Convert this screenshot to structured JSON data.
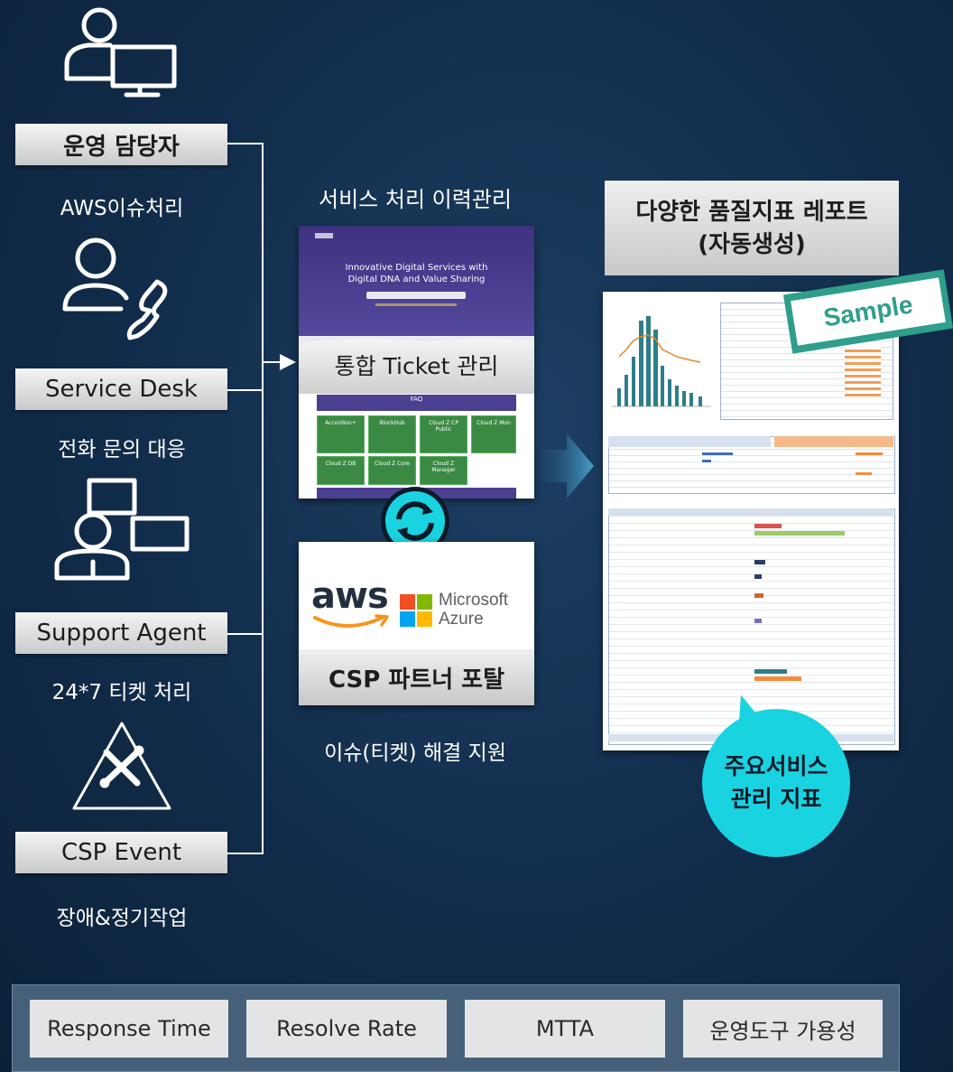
{
  "roles": [
    {
      "label": "운영 담당자",
      "caption": "AWS이슈처리",
      "icon": "user-monitor-icon"
    },
    {
      "label": "Service Desk",
      "caption": "전화 문의 대응",
      "icon": "user-phone-icon"
    },
    {
      "label": "Support Agent",
      "caption": "24*7 티켓 처리",
      "icon": "user-screens-icon"
    },
    {
      "label": "CSP Event",
      "caption": "장애&정기작업",
      "icon": "warning-tools-icon"
    }
  ],
  "middle": {
    "top_caption": "서비스 처리 이력관리",
    "ticket_label": "통합 Ticket 관리",
    "portal_hero_title": "Innovative Digital Services with Digital DNA and Value Sharing",
    "portal_faq": "FAQ",
    "portal_tiles": [
      "Accordion+",
      "BlockHub",
      "Cloud Z CP Public",
      "Cloud Z Mon",
      "Cloud Z DB",
      "Cloud Z Core",
      "Cloud Z Manager"
    ],
    "sync_icon": "sync-icon",
    "aws_text": "aws",
    "ms_text_1": "Microsoft",
    "ms_text_2": "Azure",
    "partner_label": "CSP 파트너 포탈",
    "bottom_caption": "이슈(티켓) 해결 지원"
  },
  "right": {
    "report_title_1": "다양한 품질지표 레포트",
    "report_title_2": "(자동생성)",
    "sample_label": "Sample",
    "bubble_line_1": "주요서비스",
    "bubble_line_2": "관리 지표"
  },
  "metrics": [
    "Response Time",
    "Resolve Rate",
    "MTTA",
    "운영도구 가용성"
  ],
  "colors": {
    "background": "#112c4a",
    "accent_cyan": "#1ad3e0",
    "sample_green": "#2f9e8a",
    "portal_purple": "#4b3f8f",
    "tile_green": "#3a8a43"
  }
}
